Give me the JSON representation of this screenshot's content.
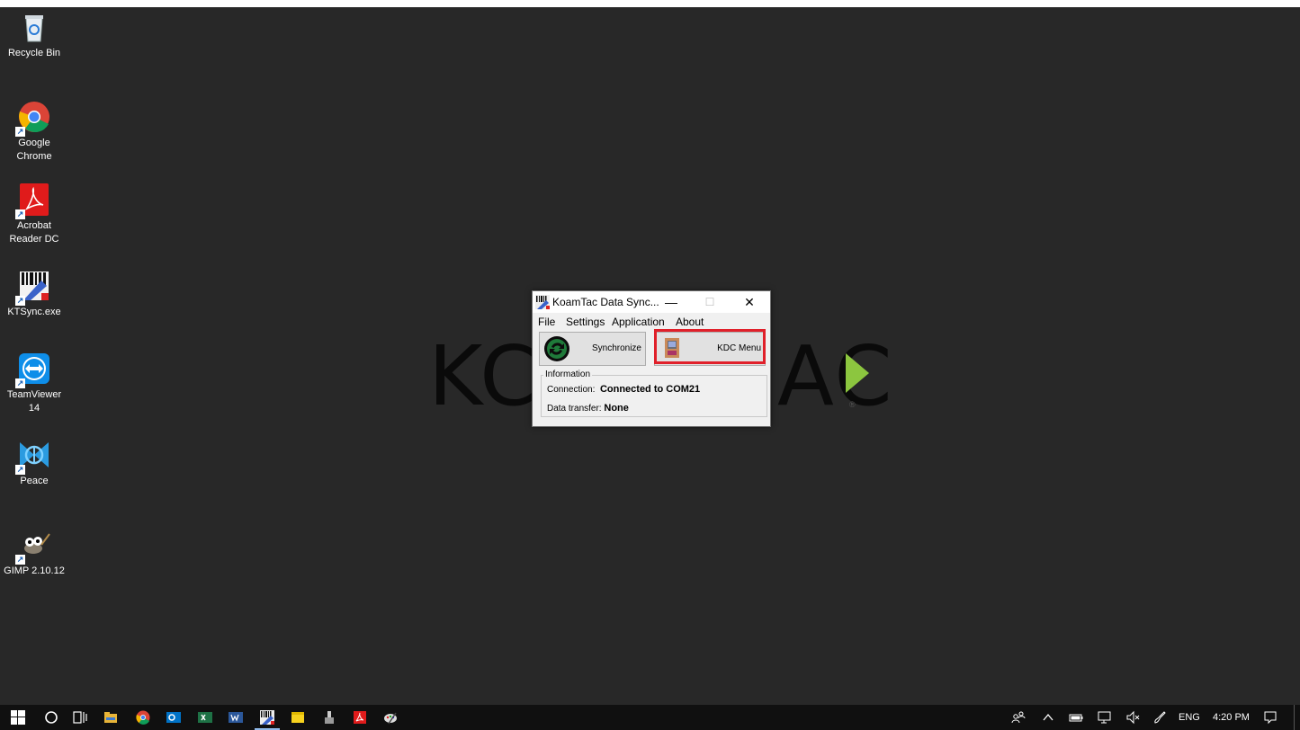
{
  "desktop": {
    "wallpaper": {
      "logo_left": "KC",
      "logo_right": "AC",
      "registered": "®"
    },
    "icons": [
      {
        "label": "Recycle Bin",
        "icon": "recycle-bin-icon"
      },
      {
        "label": "Google Chrome",
        "icon": "chrome-icon"
      },
      {
        "label": "Acrobat Reader DC",
        "icon": "acrobat-icon"
      },
      {
        "label": "KTSync.exe",
        "icon": "ktsync-icon"
      },
      {
        "label": "TeamViewer 14",
        "icon": "teamviewer-icon"
      },
      {
        "label": "Peace",
        "icon": "peace-icon"
      },
      {
        "label": "GIMP 2.10.12",
        "icon": "gimp-icon"
      }
    ]
  },
  "window": {
    "title": "KoamTac Data Sync...",
    "controls": {
      "minimize": "—",
      "maximize": "☐",
      "close": "✕"
    },
    "menu": [
      "File",
      "Settings",
      "Application",
      "About"
    ],
    "buttons": {
      "synchronize": "Synchronize",
      "kdc_menu": "KDC Menu"
    },
    "info": {
      "legend": "Information",
      "connection_label": "Connection:",
      "connection_value": "Connected to COM21",
      "transfer_label": "Data transfer:",
      "transfer_value": "None"
    }
  },
  "taskbar": {
    "tray": {
      "language": "ENG",
      "time": "4:20 PM"
    }
  },
  "colors": {
    "desktop": "#282828",
    "taskbar": "#101010",
    "highlight": "#e0202a",
    "brand_green": "#8cc63f"
  }
}
